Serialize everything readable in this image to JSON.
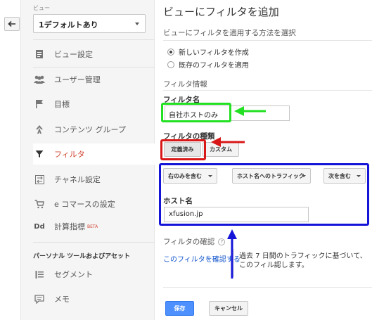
{
  "sidebar": {
    "view_caption": "ビュー",
    "view_selected": "1デフォルトあり",
    "items": [
      {
        "label": "ビュー設定",
        "icon": "document-icon"
      },
      {
        "label": "ユーザー管理",
        "icon": "users-icon"
      },
      {
        "label": "目標",
        "icon": "flag-icon"
      },
      {
        "label": "コンテンツ グループ",
        "icon": "person-walk-icon"
      },
      {
        "label": "フィルタ",
        "icon": "funnel-icon",
        "active": true
      },
      {
        "label": "チャネル設定",
        "icon": "channel-icon"
      },
      {
        "label": "e コマースの設定",
        "icon": "cart-icon"
      },
      {
        "label": "計算指標",
        "icon": "dd-icon",
        "badge": "BETA"
      }
    ],
    "personal_heading": "パーソナル ツールおよびアセット",
    "personal_items": [
      {
        "label": "セグメント",
        "icon": "segment-icon"
      },
      {
        "label": "メモ",
        "icon": "note-icon"
      }
    ]
  },
  "main": {
    "title": "ビューにフィルタを追加",
    "method_heading": "ビューにフィルタを適用する方法を選択",
    "radio_options": [
      {
        "label": "新しいフィルタを作成",
        "checked": true
      },
      {
        "label": "既存のフィルタを適用",
        "checked": false
      }
    ],
    "info_heading": "フィルタ情報",
    "filter_name_label": "フィルタ名",
    "filter_name_value": "自社ホストのみ",
    "filter_type_label": "フィルタの種類",
    "type_buttons": {
      "predefined": "定義済み",
      "custom": "カスタム"
    },
    "dropdowns": [
      "右のみを含む",
      "ホスト名へのトラフィック",
      "次を含む"
    ],
    "host_label": "ホスト名",
    "host_value": "xfusion.jp",
    "verify_heading": "フィルタの確認",
    "help_icon": "?",
    "verify_link": "このフィルタを確認する",
    "verify_desc": "過去 7 日間のトラフィックに基づいて、このフィル認します。",
    "save_label": "保存",
    "cancel_label": "キャンセル"
  },
  "annotations": {
    "green": "#22e022",
    "red": "#d81818",
    "blue": "#1414d8"
  },
  "colors": {
    "accent_red": "#d14836",
    "link_blue": "#1155cc",
    "save_blue": "#4d90fe"
  }
}
